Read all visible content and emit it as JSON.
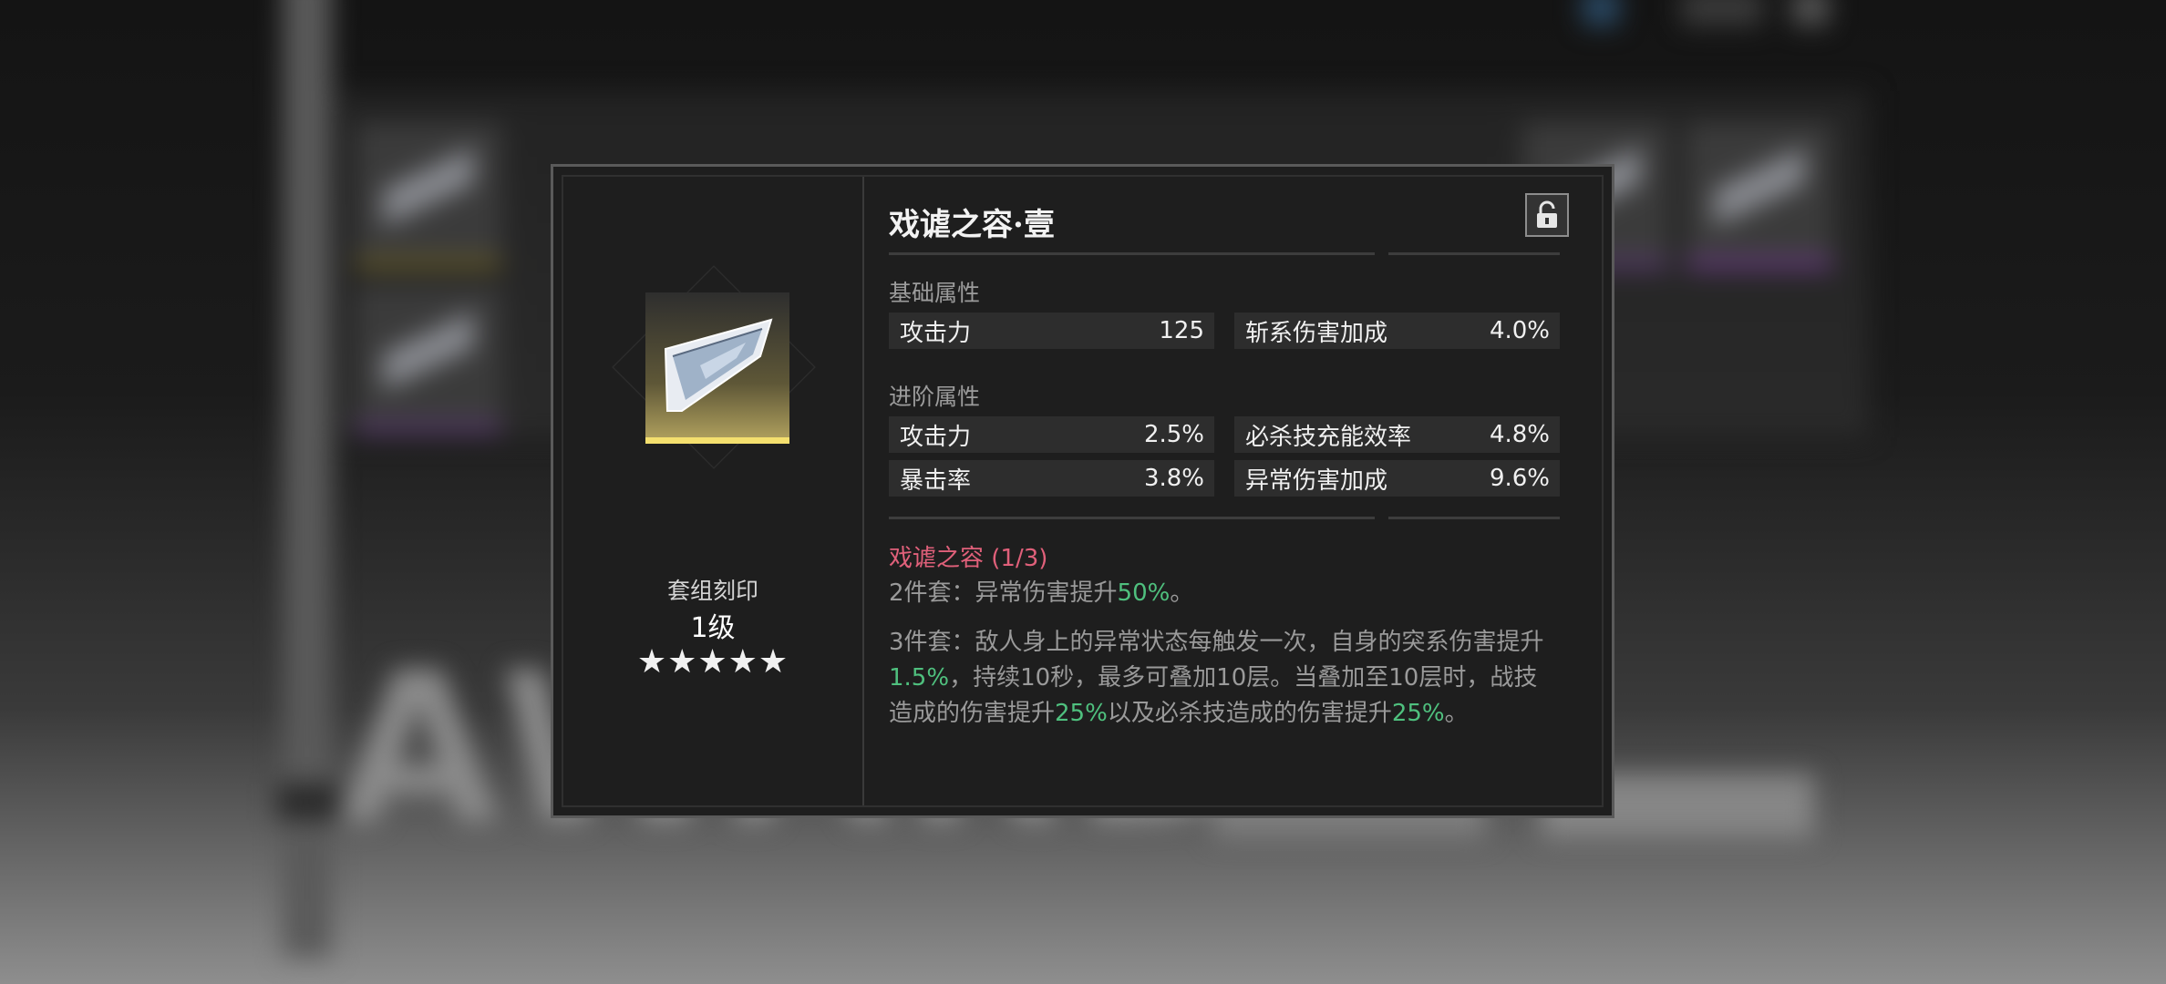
{
  "item": {
    "title": "戏谑之容·壹",
    "set_label": "套组刻印",
    "level": "1级",
    "stars": "★★★★★",
    "rarity_color": "#f4df6e",
    "lock_icon": "lock-open-icon"
  },
  "base_section": {
    "label": "基础属性",
    "stats": [
      {
        "name": "攻击力",
        "value": "125"
      },
      {
        "name": "斩系伤害加成",
        "value": "4.0%"
      }
    ]
  },
  "advanced_section": {
    "label": "进阶属性",
    "stats": [
      {
        "name": "攻击力",
        "value": "2.5%"
      },
      {
        "name": "必杀技充能效率",
        "value": "4.8%"
      },
      {
        "name": "暴击率",
        "value": "3.8%"
      },
      {
        "name": "异常伤害加成",
        "value": "9.6%"
      }
    ]
  },
  "set_bonus": {
    "name": "戏谑之容 (1/3)",
    "two_piece": {
      "text_a": "2件套：异常伤害提升",
      "hl_1": "50%",
      "text_b": "。"
    },
    "three_piece": {
      "text_a": "3件套：敌人身上的异常状态每触发一次，自身的突系伤害提升",
      "hl_1": "1.5%",
      "text_b": "，持续10秒，最多可叠加10层。当叠加至10层时，战技造成的伤害提升",
      "hl_2": "25%",
      "text_c": "以及必杀技造成的伤害提升",
      "hl_3": "25%",
      "text_d": "。"
    }
  },
  "colors": {
    "set_name": "#e0607a",
    "highlight": "#4fc07e"
  }
}
